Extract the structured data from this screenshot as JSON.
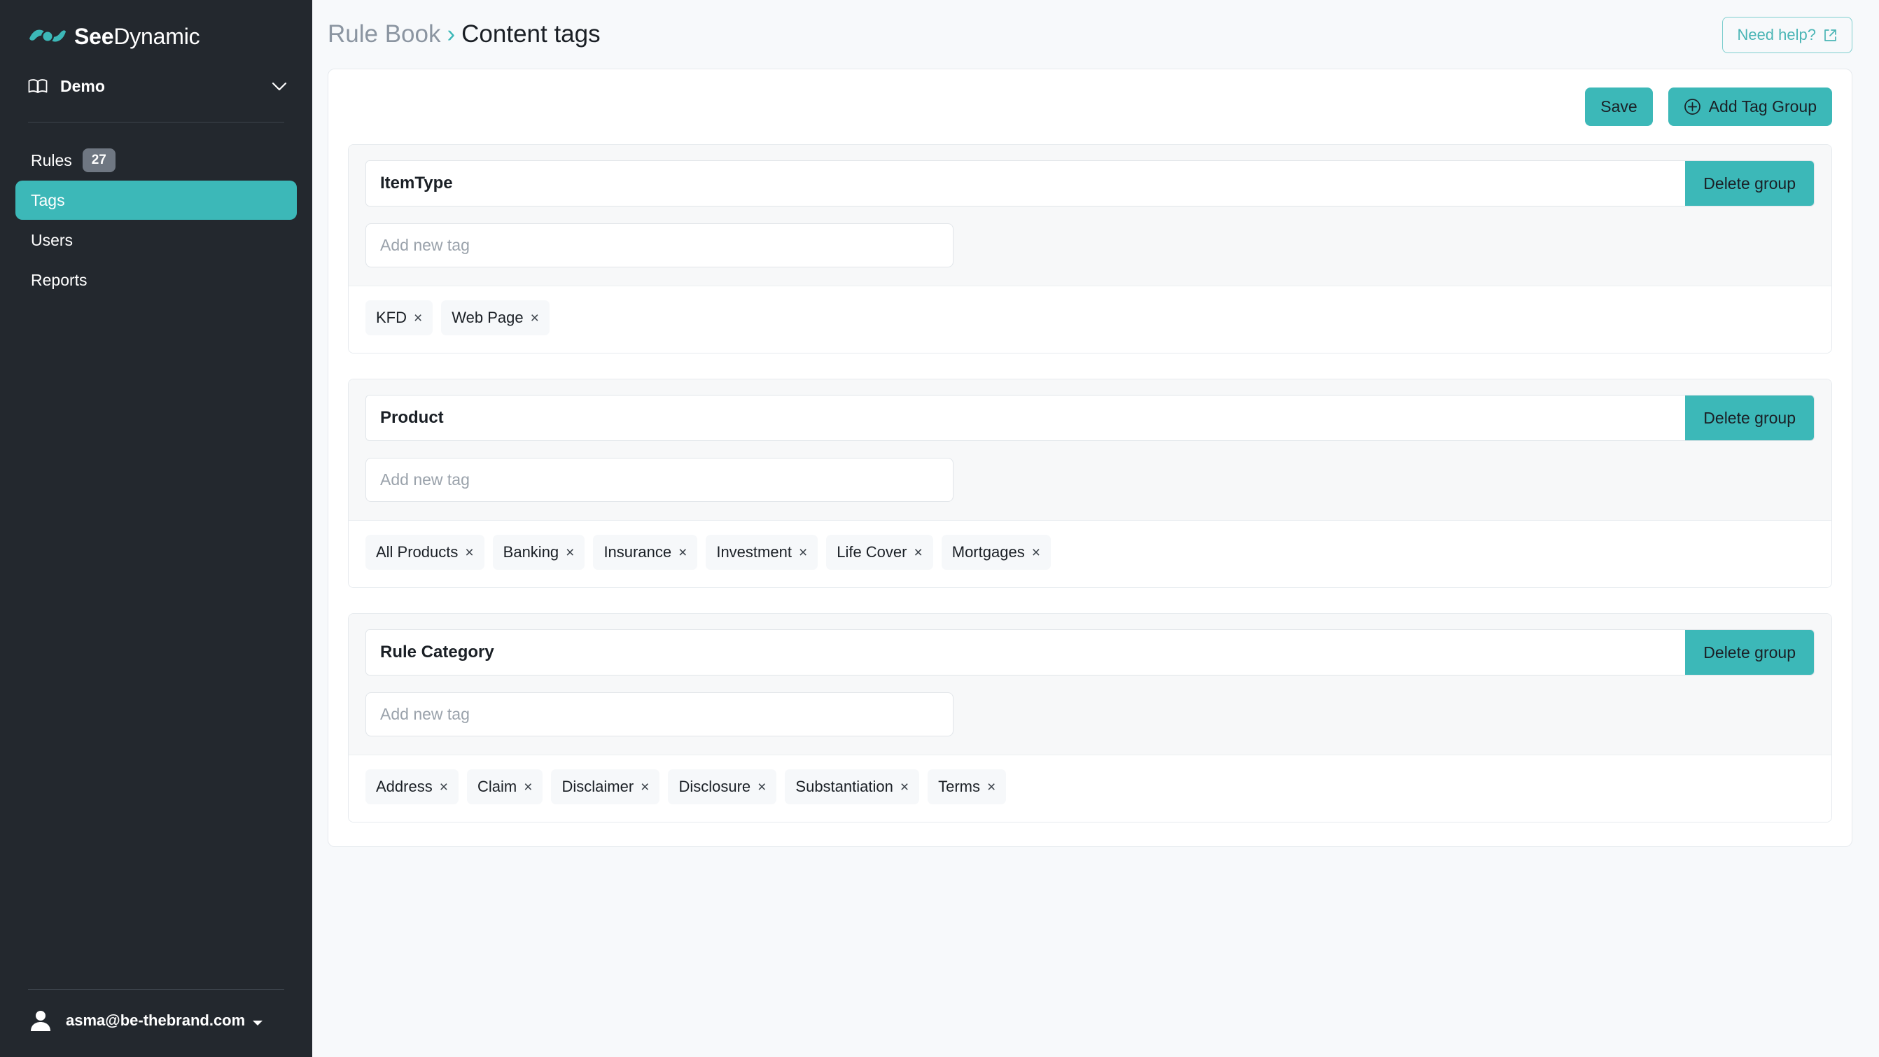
{
  "theme": {
    "accent": "#3cb8b8",
    "sidebar_bg": "#23282e",
    "page_bg": "#f7f9fb",
    "card_bg": "#ffffff",
    "group_body_bg": "#f7f8f9",
    "chip_bg": "#f6f8fa",
    "badge_bg": "#6f7782",
    "text_dark": "#1a1f25",
    "text_muted": "#8b95a1"
  },
  "sidebar": {
    "brand": {
      "bold": "See",
      "light": "Dynamic",
      "logo_icon": "eye-logo-icon"
    },
    "workspace": {
      "label": "Demo",
      "icon": "book-icon",
      "chevron": "chevron-down-icon"
    },
    "items": [
      {
        "label": "Rules",
        "badge": "27",
        "active": false,
        "name": "sidebar-item-rules"
      },
      {
        "label": "Tags",
        "badge": "",
        "active": true,
        "name": "sidebar-item-tags"
      },
      {
        "label": "Users",
        "badge": "",
        "active": false,
        "name": "sidebar-item-users"
      },
      {
        "label": "Reports",
        "badge": "",
        "active": false,
        "name": "sidebar-item-reports"
      }
    ],
    "user": {
      "email": "asma@be-thebrand.com",
      "icon": "user-avatar-icon",
      "caret": "caret-down-icon"
    }
  },
  "header": {
    "breadcrumb_parent": "Rule Book",
    "breadcrumb_separator": "›",
    "breadcrumb_current": "Content tags",
    "help_label": "Need help?",
    "help_icon": "external-link-icon"
  },
  "toolbar": {
    "save_label": "Save",
    "add_group_label": "Add Tag Group",
    "add_group_icon": "plus-circle-icon"
  },
  "group_common": {
    "delete_label": "Delete group",
    "new_tag_placeholder": "Add new tag",
    "remove_tag_icon": "×"
  },
  "groups": [
    {
      "name": "ItemType",
      "tags": [
        "KFD",
        "Web Page"
      ]
    },
    {
      "name": "Product",
      "tags": [
        "All Products",
        "Banking",
        "Insurance",
        "Investment",
        "Life Cover",
        "Mortgages"
      ]
    },
    {
      "name": "Rule Category",
      "tags": [
        "Address",
        "Claim",
        "Disclaimer",
        "Disclosure",
        "Substantiation",
        "Terms"
      ]
    }
  ]
}
